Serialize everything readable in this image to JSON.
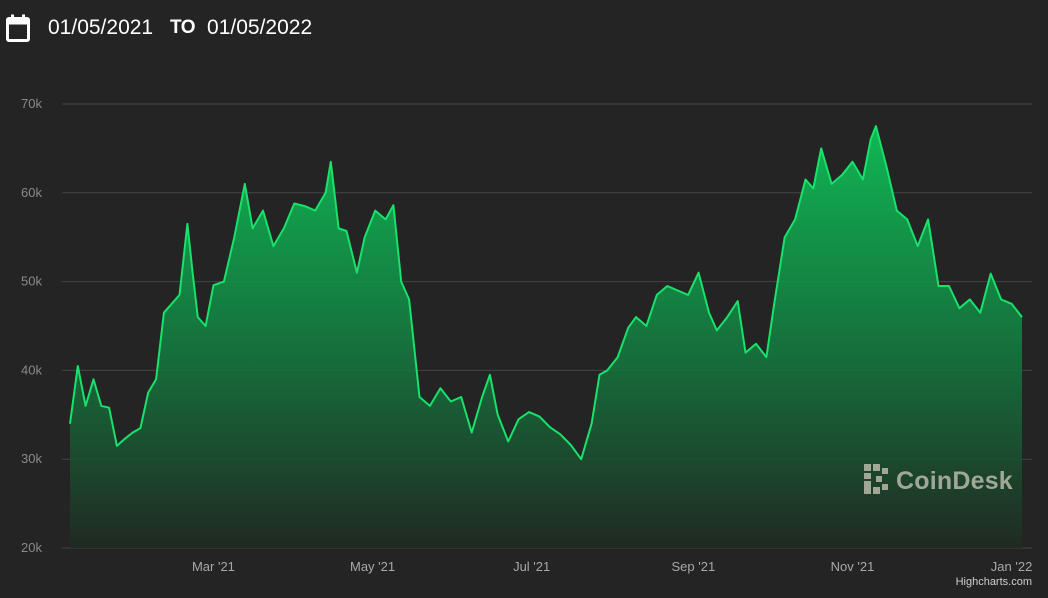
{
  "date_range": {
    "start": "01/05/2021",
    "separator": "TO",
    "end": "01/05/2022"
  },
  "icons": {
    "calendar": "calendar-icon"
  },
  "watermark": {
    "text": "CoinDesk",
    "logo": "coindesk-logo-icon"
  },
  "credits": "Highcharts.com",
  "colors": {
    "background": "#242424",
    "line": "#17e26a",
    "fill_top": "#0fbf57",
    "fill_bottom": "#1f2a22",
    "grid": "#444444",
    "tick_text": "#8a8a8a",
    "watermark": "#b9b9a8"
  },
  "chart_data": {
    "type": "area",
    "x_start": "2021-01-05",
    "x_end": "2022-01-05",
    "x_ticks": [
      {
        "label": "Mar '21",
        "date": "2021-03-01"
      },
      {
        "label": "May '21",
        "date": "2021-05-01"
      },
      {
        "label": "Jul '21",
        "date": "2021-07-01"
      },
      {
        "label": "Sep '21",
        "date": "2021-09-01"
      },
      {
        "label": "Nov '21",
        "date": "2021-11-01"
      },
      {
        "label": "Jan '22",
        "date": "2022-01-01"
      }
    ],
    "y_ticks": [
      {
        "label": "20k",
        "value": 20000
      },
      {
        "label": "30k",
        "value": 30000
      },
      {
        "label": "40k",
        "value": 40000
      },
      {
        "label": "50k",
        "value": 50000
      },
      {
        "label": "60k",
        "value": 60000
      },
      {
        "label": "70k",
        "value": 70000
      }
    ],
    "ylim": [
      20000,
      70000
    ],
    "grid": true,
    "legend": "none",
    "x": [
      "2021-01-05",
      "2021-01-08",
      "2021-01-11",
      "2021-01-14",
      "2021-01-17",
      "2021-01-20",
      "2021-01-23",
      "2021-01-26",
      "2021-01-29",
      "2021-02-01",
      "2021-02-04",
      "2021-02-07",
      "2021-02-10",
      "2021-02-13",
      "2021-02-16",
      "2021-02-19",
      "2021-02-21",
      "2021-02-23",
      "2021-02-26",
      "2021-03-01",
      "2021-03-05",
      "2021-03-09",
      "2021-03-13",
      "2021-03-16",
      "2021-03-20",
      "2021-03-24",
      "2021-03-28",
      "2021-04-01",
      "2021-04-05",
      "2021-04-09",
      "2021-04-13",
      "2021-04-15",
      "2021-04-18",
      "2021-04-21",
      "2021-04-25",
      "2021-04-28",
      "2021-05-02",
      "2021-05-06",
      "2021-05-09",
      "2021-05-12",
      "2021-05-15",
      "2021-05-19",
      "2021-05-23",
      "2021-05-27",
      "2021-05-31",
      "2021-06-04",
      "2021-06-08",
      "2021-06-12",
      "2021-06-15",
      "2021-06-18",
      "2021-06-22",
      "2021-06-26",
      "2021-06-30",
      "2021-07-04",
      "2021-07-08",
      "2021-07-12",
      "2021-07-16",
      "2021-07-20",
      "2021-07-24",
      "2021-07-27",
      "2021-07-30",
      "2021-08-03",
      "2021-08-07",
      "2021-08-10",
      "2021-08-14",
      "2021-08-18",
      "2021-08-22",
      "2021-08-26",
      "2021-08-30",
      "2021-09-03",
      "2021-09-07",
      "2021-09-10",
      "2021-09-14",
      "2021-09-18",
      "2021-09-21",
      "2021-09-25",
      "2021-09-29",
      "2021-10-02",
      "2021-10-06",
      "2021-10-10",
      "2021-10-14",
      "2021-10-17",
      "2021-10-20",
      "2021-10-24",
      "2021-10-28",
      "2021-11-01",
      "2021-11-05",
      "2021-11-08",
      "2021-11-10",
      "2021-11-14",
      "2021-11-18",
      "2021-11-22",
      "2021-11-26",
      "2021-11-30",
      "2021-12-04",
      "2021-12-08",
      "2021-12-12",
      "2021-12-16",
      "2021-12-20",
      "2021-12-24",
      "2021-12-28",
      "2022-01-01",
      "2022-01-05"
    ],
    "series": [
      {
        "values": [
          34000,
          40500,
          36000,
          39000,
          36000,
          35800,
          31500,
          32300,
          33000,
          33500,
          37500,
          39000,
          46500,
          47500,
          48500,
          56500,
          51000,
          46000,
          45000,
          49600,
          50000,
          55000,
          61000,
          56000,
          58000,
          54000,
          56000,
          58800,
          58500,
          58000,
          60000,
          63500,
          56000,
          55700,
          51000,
          55000,
          58000,
          57000,
          58600,
          50000,
          48000,
          37000,
          36000,
          38000,
          36500,
          37000,
          33000,
          37000,
          39500,
          35000,
          32000,
          34500,
          35300,
          34800,
          33600,
          32800,
          31600,
          30000,
          34000,
          39500,
          40000,
          41500,
          44800,
          46000,
          45000,
          48500,
          49500,
          49000,
          48500,
          51000,
          46500,
          44500,
          46000,
          47800,
          42000,
          43000,
          41500,
          47500,
          55000,
          57000,
          61500,
          60500,
          65000,
          61000,
          62000,
          63500,
          61500,
          66000,
          67500,
          63000,
          58000,
          57000,
          54000,
          57000,
          49500,
          49500,
          47000,
          48000,
          46500,
          50900,
          48000,
          47500,
          46000
        ]
      }
    ]
  }
}
